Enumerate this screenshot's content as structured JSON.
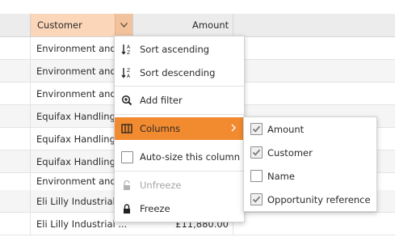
{
  "columns": {
    "customer": "Customer",
    "amount": "Amount"
  },
  "rows": [
    {
      "customer": "Environment and",
      "amount": ""
    },
    {
      "customer": "Environment and",
      "amount": ""
    },
    {
      "customer": "Environment and",
      "amount": ""
    },
    {
      "customer": "Equifax Handling",
      "amount": ""
    },
    {
      "customer": "Equifax Handling",
      "amount": ""
    },
    {
      "customer": "Equifax Handling",
      "amount": ""
    },
    {
      "customer": "Environment and",
      "amount": ""
    },
    {
      "customer": "Eli Lilly Industrial",
      "amount": ""
    },
    {
      "customer": "Eli Lilly Industrial ...",
      "amount": "£11,880.00"
    }
  ],
  "menu": {
    "sort_asc": "Sort ascending",
    "sort_desc": "Sort descending",
    "add_filter": "Add filter",
    "columns": "Columns",
    "autosize": "Auto-size this column",
    "unfreeze": "Unfreeze",
    "freeze": "Freeze"
  },
  "submenu": [
    {
      "label": "Amount",
      "checked": true
    },
    {
      "label": "Customer",
      "checked": true
    },
    {
      "label": "Name",
      "checked": false
    },
    {
      "label": "Opportunity reference",
      "checked": true
    }
  ],
  "colors": {
    "highlight": "#f28a2f",
    "header_active": "#fbd6b9"
  }
}
